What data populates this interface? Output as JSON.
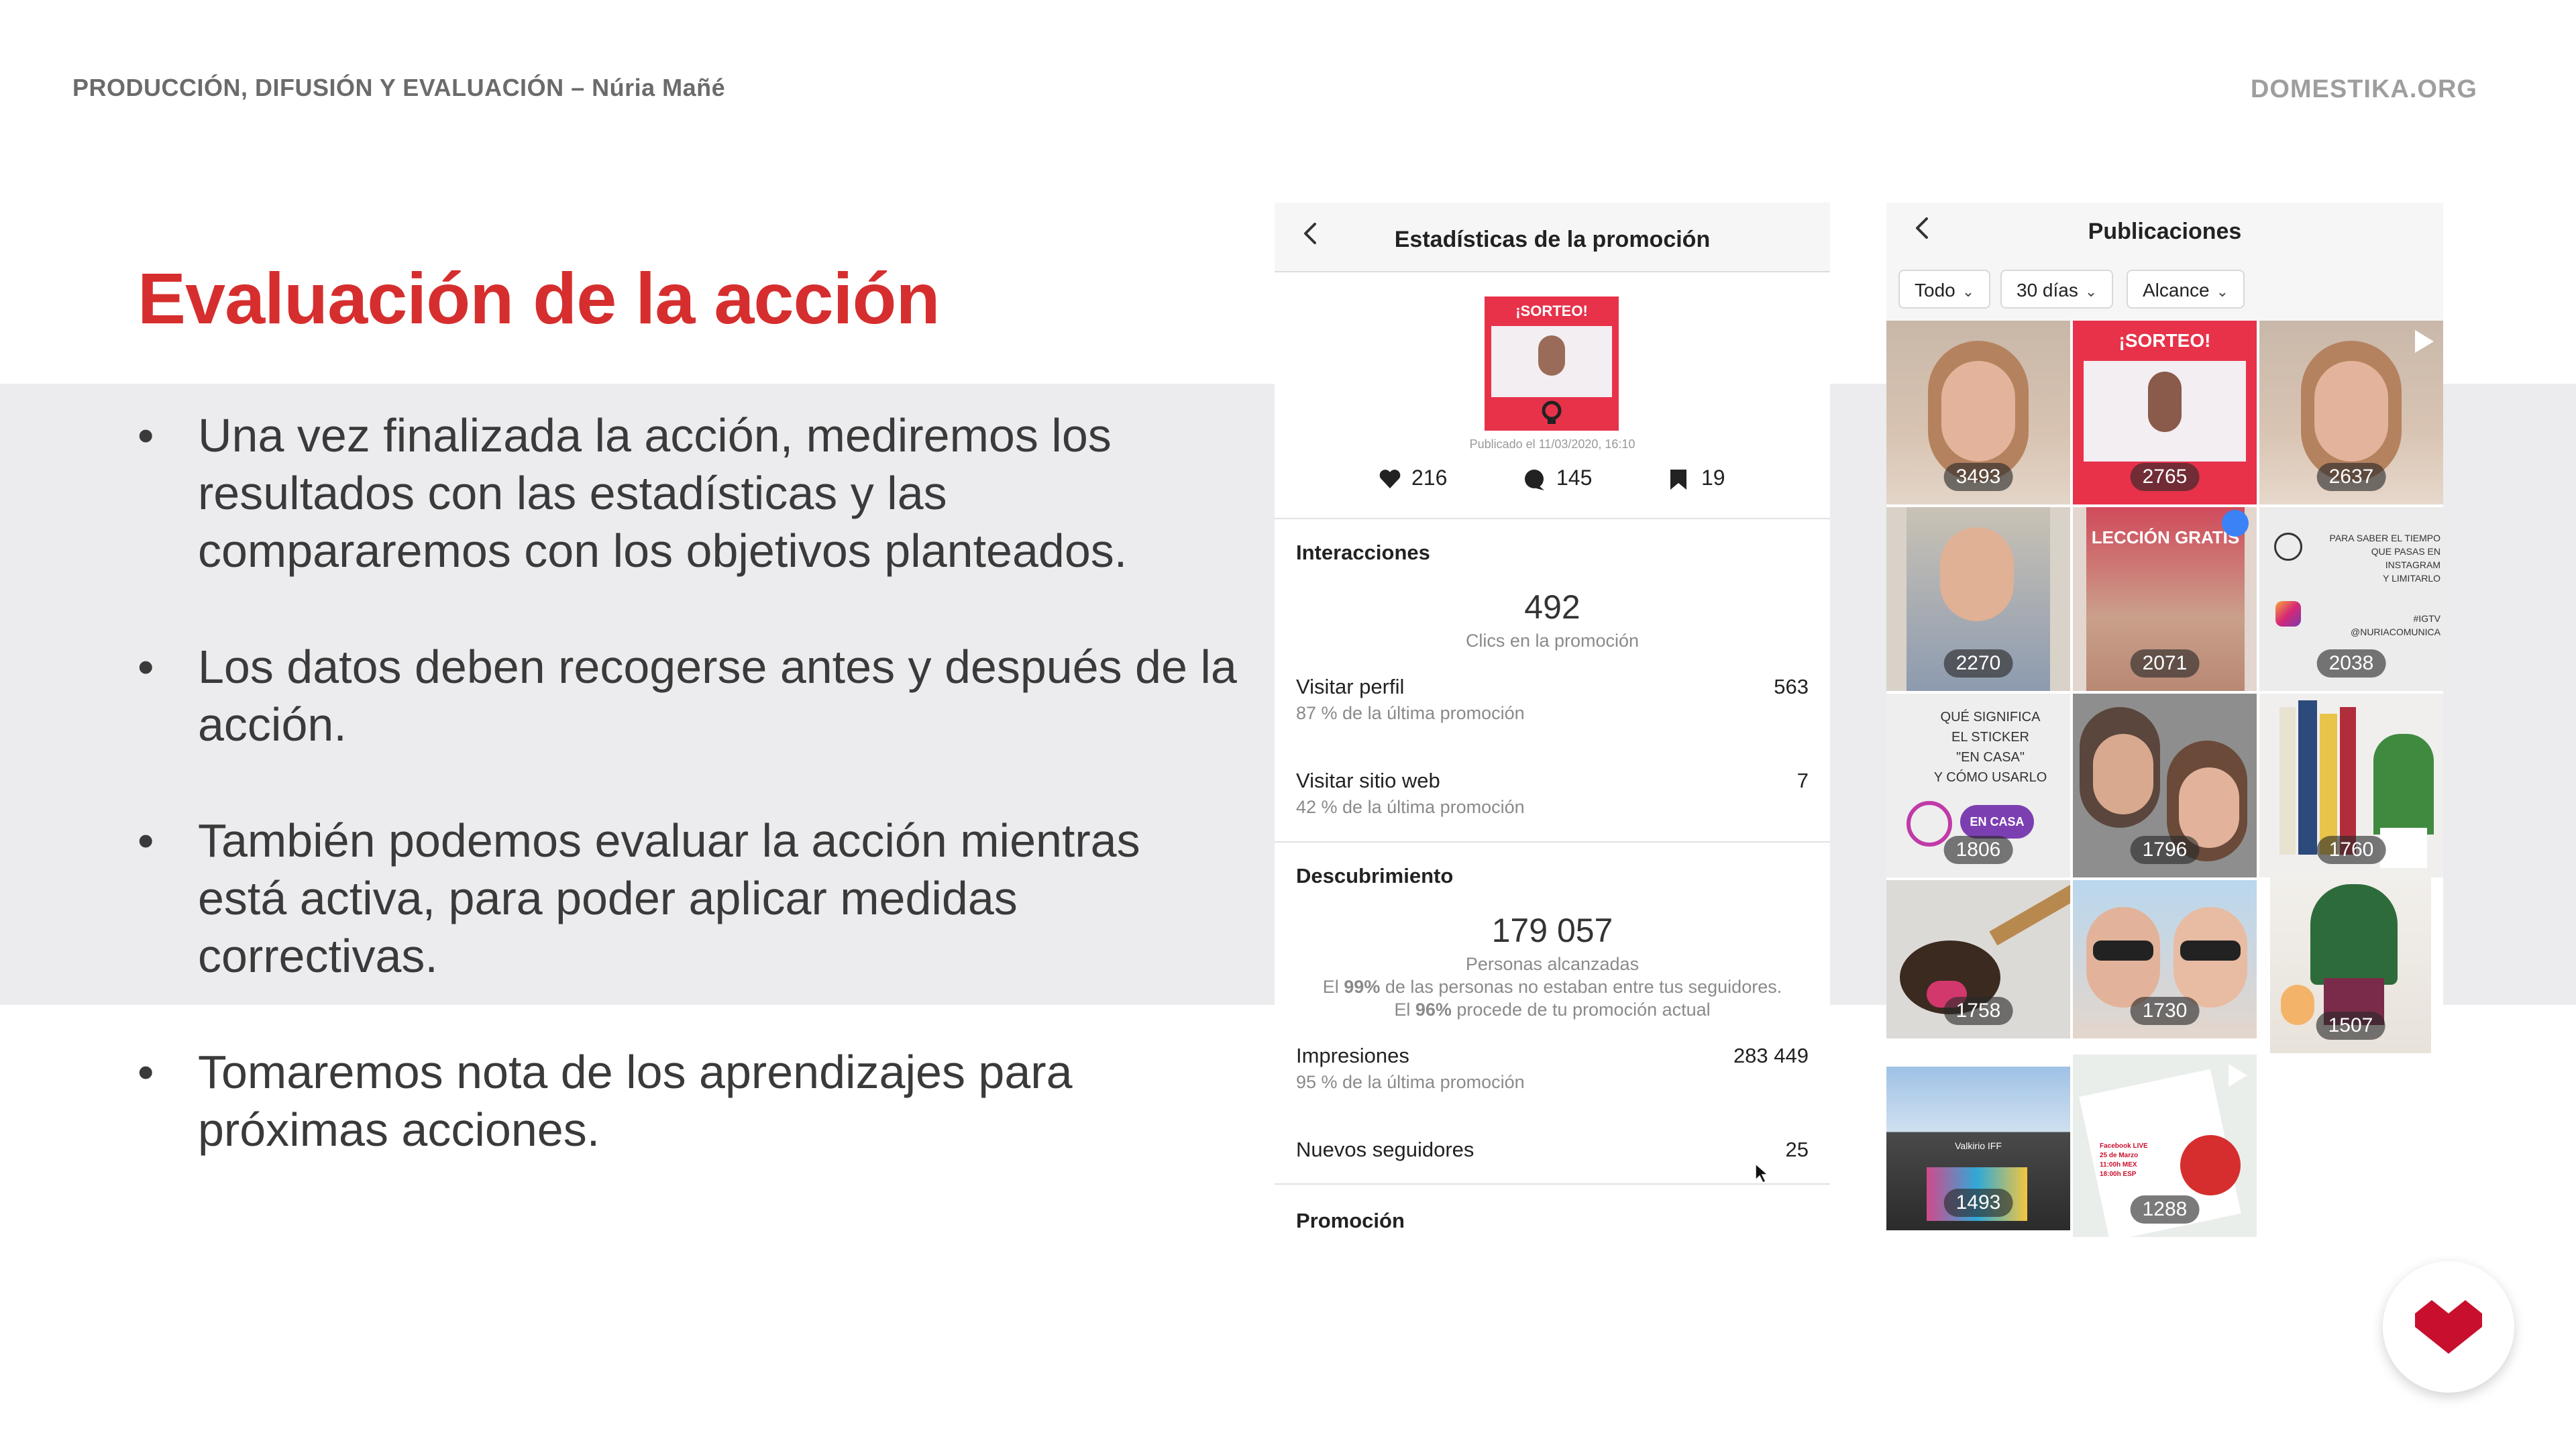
{
  "slide": {
    "course_title": "PRODUCCIÓN, DIFUSIÓN Y EVALUACIÓN – Núria Mañé",
    "brand": "DOMESTIKA.ORG",
    "title": "Evaluación de la acción",
    "bullet_symbol": "•",
    "bullets": [
      "Una vez finalizada la acción, mediremos los resultados con las estadísticas y las compararemos con los objetivos planteados.",
      "Los datos deben recogerse antes y después de la acción.",
      "También podemos evaluar la acción mientras está activa, para poder aplicar medidas correctivas.",
      "Tomaremos nota de los aprendizajes para próximas acciones."
    ],
    "colors": {
      "title": "#d62e2e",
      "band": "#ececef",
      "logo": "#c8102e"
    }
  },
  "stats_panel": {
    "header_title": "Estadísticas de la promoción",
    "post_banner": "¡SORTEO!",
    "published": "Publicado el 11/03/2020, 16:10",
    "likes": "216",
    "comments": "145",
    "saves": "19",
    "interactions": {
      "title": "Interacciones",
      "clicks_value": "492",
      "clicks_label": "Clics en la promoción",
      "rows": [
        {
          "label": "Visitar perfil",
          "sub": "87 % de la última promoción",
          "value": "563"
        },
        {
          "label": "Visitar sitio web",
          "sub": "42 % de la última promoción",
          "value": "7"
        }
      ]
    },
    "discovery": {
      "title": "Descubrimiento",
      "reach_value": "179 057",
      "reach_label": "Personas alcanzadas",
      "note1_pre": "El ",
      "note1_bold": "99%",
      "note1_post": " de las personas no estaban entre tus seguidores.",
      "note2_pre": "El ",
      "note2_bold": "96%",
      "note2_post": " procede de tu promoción actual",
      "rows": [
        {
          "label": "Impresiones",
          "sub": "95 % de la última promoción",
          "value": "283 449"
        },
        {
          "label": "Nuevos seguidores",
          "sub": "",
          "value": "25"
        }
      ]
    },
    "promotion_title": "Promoción"
  },
  "pubs_panel": {
    "header_title": "Publicaciones",
    "filters": [
      "Todo",
      "30 días",
      "Alcance"
    ],
    "tile_text": {
      "sorteo": "¡SORTEO!",
      "leccion": "LECCIÓN GRATIS",
      "igtv_lines": [
        "PARA SABER EL TIEMPO",
        "QUE PASAS EN INSTAGRAM",
        "Y LIMITARLO",
        "#IGTV",
        "@NURIACOMUNICA"
      ],
      "sticker_lines": [
        "QUÉ SIGNIFICA",
        "EL STICKER",
        "\"EN CASA\"",
        "Y CÓMO USARLO"
      ],
      "en_casa": "EN CASA",
      "live_lines": [
        "Facebook LIVE",
        "25 de Marzo",
        "11:00h MEX",
        "18:00h ESP"
      ],
      "building": "Valkirio IFF"
    },
    "counts": [
      "3493",
      "2765",
      "2637",
      "2270",
      "2071",
      "2038",
      "1806",
      "1796",
      "1760",
      "1758",
      "1730",
      "1507",
      "1493",
      "1288"
    ]
  }
}
